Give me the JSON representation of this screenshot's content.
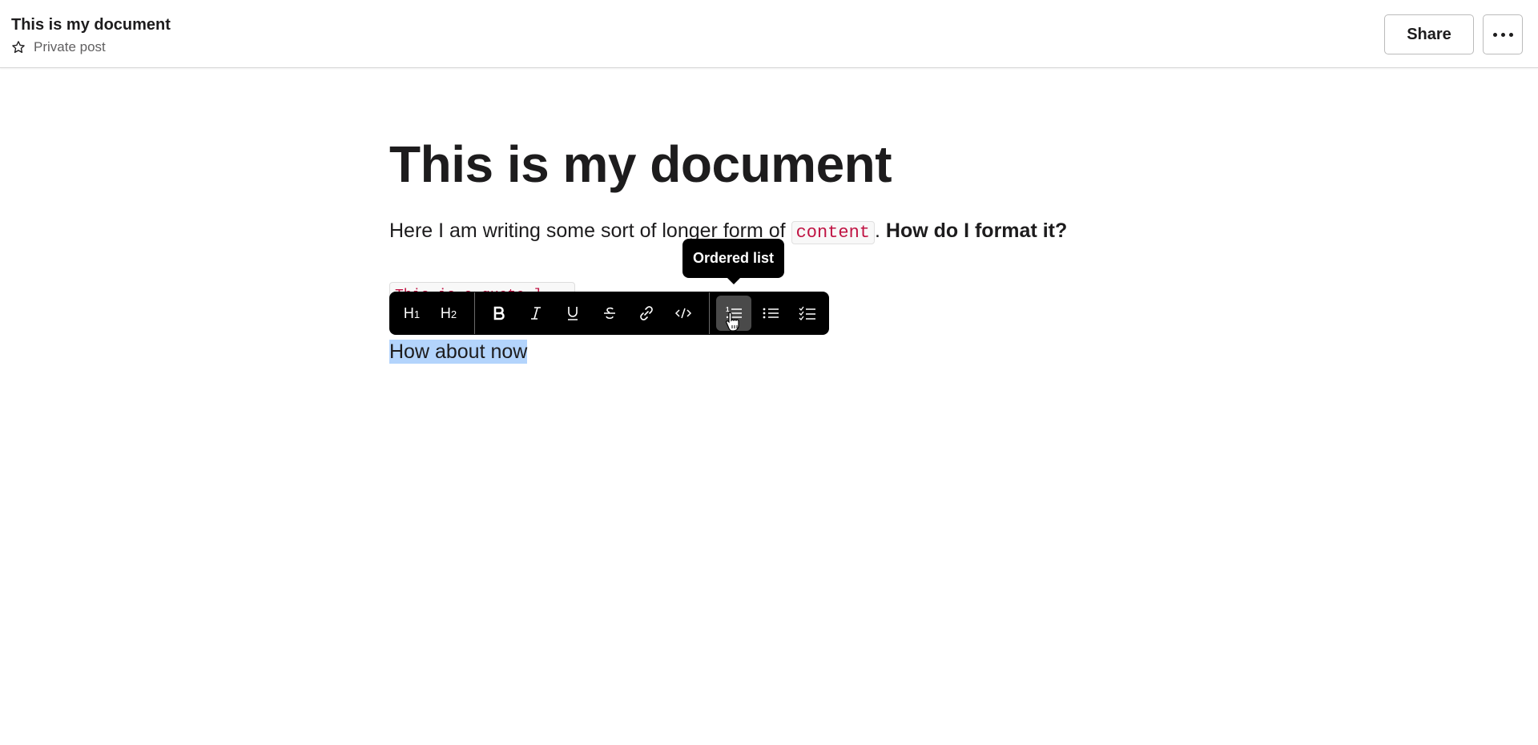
{
  "header": {
    "title": "This is my document",
    "visibility": "Private post",
    "star_icon": "star-outline-icon",
    "share_label": "Share",
    "more_icon": "more-horizontal-icon"
  },
  "document": {
    "title": "This is my document",
    "paragraph": {
      "text_before": "Here I am writing some sort of longer form of ",
      "code": "content",
      "text_after": ". ",
      "bold": "How do I format it?"
    },
    "code_block": "This is a quote ]",
    "selected_text": "How about now"
  },
  "toolbar": {
    "buttons": [
      {
        "name": "heading-1",
        "label": "H1",
        "icon": "heading-1-icon"
      },
      {
        "name": "heading-2",
        "label": "H2",
        "icon": "heading-2-icon"
      },
      {
        "name": "bold",
        "icon": "bold-icon"
      },
      {
        "name": "italic",
        "icon": "italic-icon"
      },
      {
        "name": "underline",
        "icon": "underline-icon"
      },
      {
        "name": "strikethrough",
        "icon": "strikethrough-icon"
      },
      {
        "name": "link",
        "icon": "link-icon"
      },
      {
        "name": "code",
        "icon": "code-icon"
      },
      {
        "name": "ordered-list",
        "icon": "ordered-list-icon",
        "active": true
      },
      {
        "name": "bulleted-list",
        "icon": "bulleted-list-icon"
      },
      {
        "name": "checklist",
        "icon": "checklist-icon"
      }
    ],
    "tooltip": "Ordered list"
  },
  "colors": {
    "inline_code": "#c01343",
    "selection": "#b3d4fc",
    "toolbar_bg": "#000000",
    "active_button": "#4a4a4a"
  }
}
